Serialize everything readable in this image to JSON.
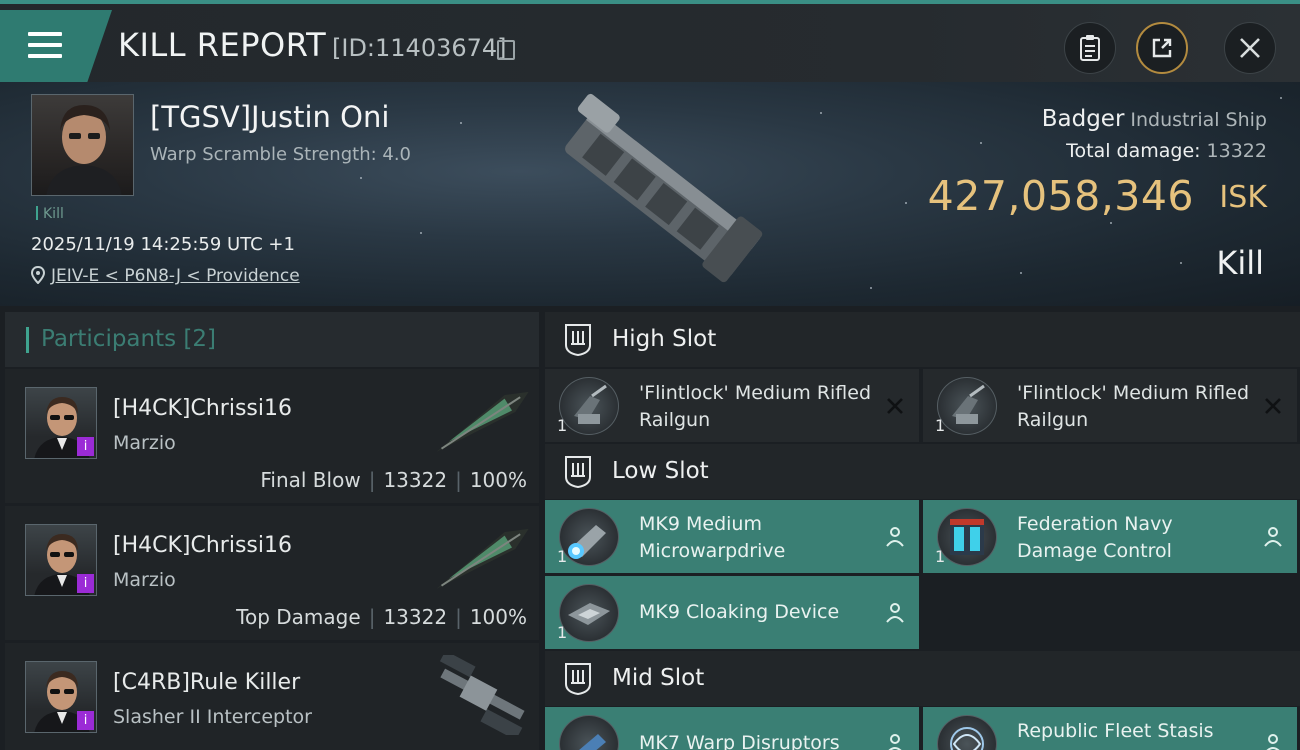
{
  "header": {
    "title": "KILL REPORT",
    "report_id": "[ID:11403674]",
    "icons": [
      "menu-icon",
      "copy-icon",
      "clipboard-icon",
      "share-icon",
      "close-icon"
    ]
  },
  "victim": {
    "name": "[TGSV]Justin Oni",
    "warp_scramble": "Warp Scramble Strength: 4.0",
    "kill_tag": "Kill",
    "timestamp": "2025/11/19 14:25:59 UTC +1",
    "location": "JEIV-E < P6N8-J < Providence",
    "ship_name": "Badger",
    "ship_type": "Industrial Ship",
    "total_damage_label": "Total damage:",
    "total_damage": "13322",
    "isk_value": "427,058,346",
    "isk_unit": "ISK",
    "result": "Kill"
  },
  "participants": {
    "title": "Participants [2]",
    "rows": [
      {
        "name": "[H4CK]Chrissi16",
        "ship": "Marzio",
        "role": "Final Blow",
        "damage": "13322",
        "percent": "100%"
      },
      {
        "name": "[H4CK]Chrissi16",
        "ship": "Marzio",
        "role": "Top Damage",
        "damage": "13322",
        "percent": "100%"
      },
      {
        "name": "[C4RB]Rule Killer",
        "ship": "Slasher II Interceptor",
        "role": "",
        "damage": "",
        "percent": ""
      }
    ]
  },
  "fitting": {
    "high_slot": {
      "label": "High Slot",
      "modules": [
        {
          "qty": "1",
          "name": "'Flintlock' Medium Rifled Railgun",
          "state": "destroyed"
        },
        {
          "qty": "1",
          "name": "'Flintlock' Medium Rifled Railgun",
          "state": "destroyed"
        }
      ]
    },
    "low_slot": {
      "label": "Low Slot",
      "modules": [
        {
          "qty": "1",
          "name": "MK9 Medium Microwarpdrive",
          "state": "dropped"
        },
        {
          "qty": "1",
          "name": "Federation Navy Damage Control",
          "state": "dropped"
        },
        {
          "qty": "1",
          "name": "MK9 Cloaking Device",
          "state": "dropped"
        }
      ]
    },
    "mid_slot": {
      "label": "Mid Slot",
      "modules": [
        {
          "qty": "",
          "name": "MK7 Warp Disruptors",
          "state": "dropped"
        },
        {
          "qty": "",
          "name": "Republic Fleet Stasis",
          "state": "dropped"
        }
      ]
    }
  },
  "colors": {
    "accent": "#3a8f85",
    "isk": "#e6c27d",
    "fitted_module": "#3a7f74"
  }
}
